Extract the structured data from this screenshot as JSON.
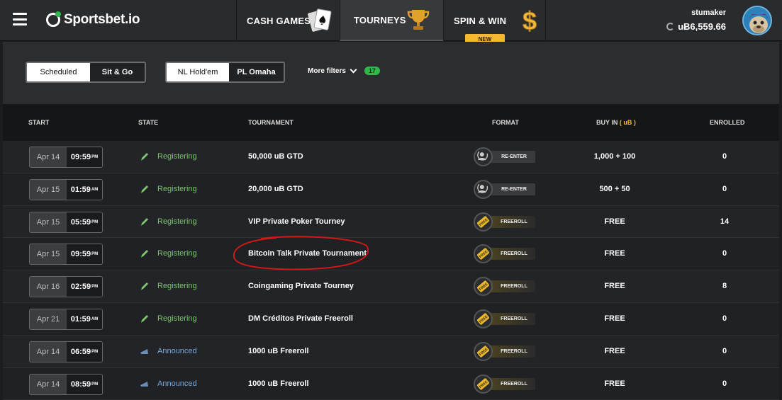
{
  "header": {
    "logo": "Sportsbet.io",
    "nav": [
      {
        "label": "CASH GAMES",
        "icon": "playing-cards-icon"
      },
      {
        "label": "TOURNEYS",
        "icon": "trophy-icon"
      },
      {
        "label": "SPIN & WIN",
        "icon": "dollar-icon",
        "badge": "NEW"
      }
    ],
    "user": {
      "name": "stumaker",
      "balance": "uɃ6,559.66"
    }
  },
  "filters": {
    "type_tabs": [
      "Scheduled",
      "Sit & Go"
    ],
    "game_tabs": [
      "NL Hold'em",
      "PL Omaha"
    ],
    "more_filters": "More filters",
    "count": "17"
  },
  "table": {
    "headers": {
      "start": "START",
      "state": "STATE",
      "tournament": "TOURNAMENT",
      "format": "FORMAT",
      "buyin": "BUY IN",
      "buyin_unit": "( uB )",
      "enrolled": "ENROLLED"
    },
    "rows": [
      {
        "date": "Apr 14",
        "time": "09:59",
        "ampm": "PM",
        "state": "Registering",
        "name": "50,000 uB GTD",
        "format": "RE-ENTER",
        "buyin": "1,000 + 100",
        "enrolled": "0"
      },
      {
        "date": "Apr 15",
        "time": "01:59",
        "ampm": "AM",
        "state": "Registering",
        "name": "20,000 uB GTD",
        "format": "RE-ENTER",
        "buyin": "500 + 50",
        "enrolled": "0"
      },
      {
        "date": "Apr 15",
        "time": "05:59",
        "ampm": "PM",
        "state": "Registering",
        "name": "VIP Private Poker Tourney",
        "format": "FREEROLL",
        "buyin": "FREE",
        "enrolled": "14"
      },
      {
        "date": "Apr 15",
        "time": "09:59",
        "ampm": "PM",
        "state": "Registering",
        "name": "Bitcoin Talk Private Tournament",
        "format": "FREEROLL",
        "buyin": "FREE",
        "enrolled": "0"
      },
      {
        "date": "Apr 16",
        "time": "02:59",
        "ampm": "PM",
        "state": "Registering",
        "name": "Coingaming Private Tourney",
        "format": "FREEROLL",
        "buyin": "FREE",
        "enrolled": "8"
      },
      {
        "date": "Apr 21",
        "time": "01:59",
        "ampm": "AM",
        "state": "Registering",
        "name": "DM Créditos Private Freeroll",
        "format": "FREEROLL",
        "buyin": "FREE",
        "enrolled": "0"
      },
      {
        "date": "Apr 14",
        "time": "06:59",
        "ampm": "PM",
        "state": "Announced",
        "name": "1000 uB Freeroll",
        "format": "FREEROLL",
        "buyin": "FREE",
        "enrolled": "0"
      },
      {
        "date": "Apr 14",
        "time": "08:59",
        "ampm": "PM",
        "state": "Announced",
        "name": "1000 uB Freeroll",
        "format": "FREEROLL",
        "buyin": "FREE",
        "enrolled": "0"
      }
    ]
  },
  "colors": {
    "accent_green": "#2fb94a",
    "registering": "#7ec66f",
    "announced": "#7aa9d8",
    "buyin_unit": "#f5b82e",
    "annotation": "#d01818"
  }
}
